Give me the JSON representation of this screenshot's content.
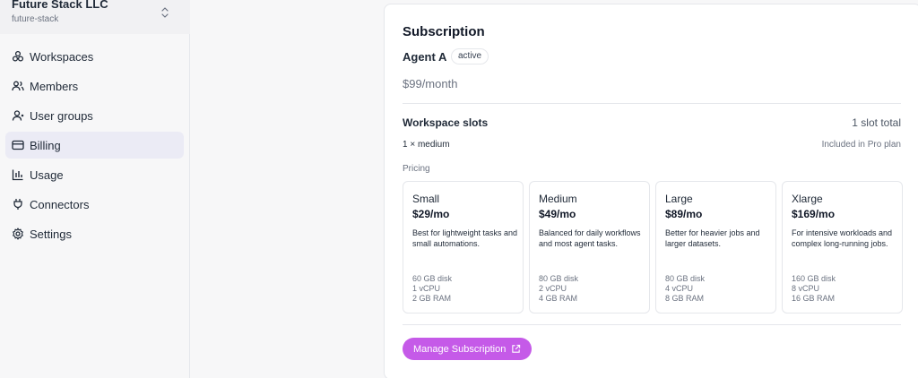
{
  "org": {
    "name": "Future Stack LLC",
    "slug": "future-stack"
  },
  "nav": [
    {
      "label": "Workspaces",
      "icon": "workspaces-icon"
    },
    {
      "label": "Members",
      "icon": "members-icon"
    },
    {
      "label": "User groups",
      "icon": "user-groups-icon"
    },
    {
      "label": "Billing",
      "icon": "billing-icon",
      "active": true
    },
    {
      "label": "Usage",
      "icon": "usage-chart-icon"
    },
    {
      "label": "Connectors",
      "icon": "plug-icon"
    },
    {
      "label": "Settings",
      "icon": "gear-icon"
    }
  ],
  "subscription": {
    "title": "Subscription",
    "agent": "Agent A",
    "status": "active",
    "price": "$99/month"
  },
  "slots": {
    "title": "Workspace slots",
    "total": "1 slot total",
    "detail": "1 × medium",
    "note": "Included in Pro plan"
  },
  "pricing": {
    "label": "Pricing",
    "plans": [
      {
        "name": "Small",
        "price": "$29/mo",
        "desc": "Best for lightweight tasks and small automations.",
        "disk": "60 GB disk",
        "cpu": "1 vCPU",
        "ram": "2 GB RAM"
      },
      {
        "name": "Medium",
        "price": "$49/mo",
        "desc": "Balanced for daily workflows and most agent tasks.",
        "disk": "80 GB disk",
        "cpu": "2 vCPU",
        "ram": "4 GB RAM"
      },
      {
        "name": "Large",
        "price": "$89/mo",
        "desc": "Better for heavier jobs and larger datasets.",
        "disk": "80 GB disk",
        "cpu": "4 vCPU",
        "ram": "8 GB RAM"
      },
      {
        "name": "Xlarge",
        "price": "$169/mo",
        "desc": "For intensive workloads and complex long-running jobs.",
        "disk": "160 GB disk",
        "cpu": "8 vCPU",
        "ram": "16 GB RAM"
      }
    ]
  },
  "manage_button": {
    "label": "Manage Subscription",
    "icon": "external-link-icon",
    "color": "#c55ae8"
  },
  "colors": {
    "accent": "#c55ae8",
    "active_nav_bg": "#ebebf5"
  }
}
